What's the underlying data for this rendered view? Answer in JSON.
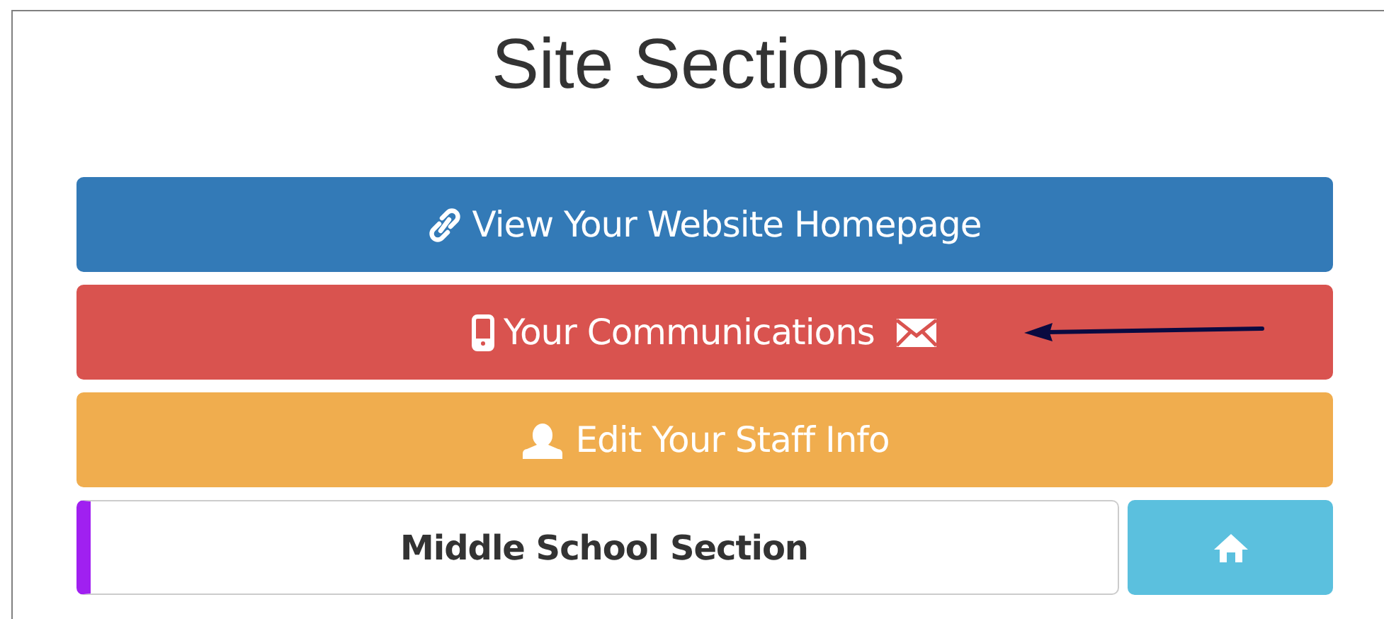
{
  "title": "Site Sections",
  "buttons": [
    {
      "kind": "link",
      "label": "View Your Website Homepage",
      "color": "#337ab7",
      "pointer": false
    },
    {
      "kind": "phone",
      "label": "Your Communications",
      "color": "#d9534f",
      "pointer": true
    },
    {
      "kind": "user",
      "label": "Edit Your Staff Info",
      "color": "#f0ad4e",
      "pointer": false
    }
  ],
  "section": {
    "label": "Middle School Section",
    "color": "#a020f0"
  }
}
